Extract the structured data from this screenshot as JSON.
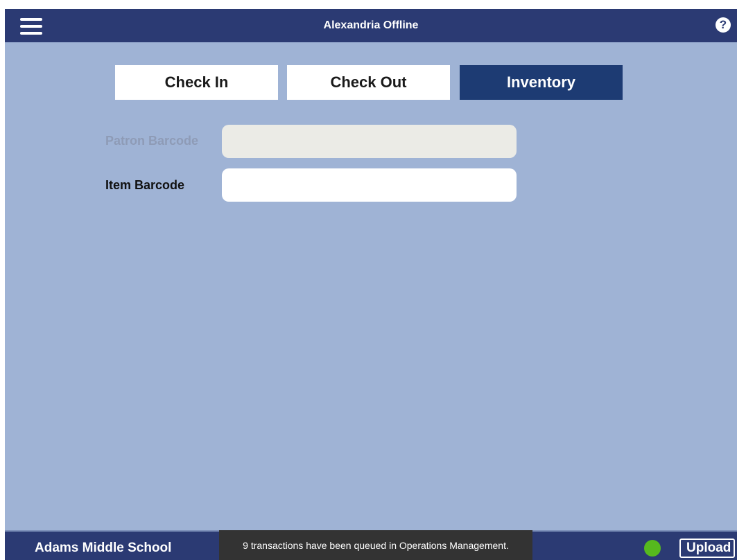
{
  "header": {
    "title": "Alexandria Offline",
    "menu_icon": "hamburger-menu-icon",
    "help_icon": "help-question-icon",
    "help_glyph": "?"
  },
  "tabs": [
    {
      "label": "Check In",
      "active": false
    },
    {
      "label": "Check Out",
      "active": false
    },
    {
      "label": "Inventory",
      "active": true
    }
  ],
  "form": {
    "patron_barcode": {
      "label": "Patron Barcode",
      "value": "",
      "disabled": true
    },
    "item_barcode": {
      "label": "Item Barcode",
      "value": "",
      "disabled": false
    }
  },
  "footer": {
    "school_name": "Adams Middle School",
    "toast": "9 transactions have been queued in Operations Management.",
    "status_color": "#56b81e",
    "upload_label": "Upload"
  },
  "colors": {
    "header_bg": "#2b3a73",
    "content_bg": "#9fb3d5",
    "active_tab_bg": "#1d3b73",
    "disabled_input_bg": "#ebebe6"
  }
}
